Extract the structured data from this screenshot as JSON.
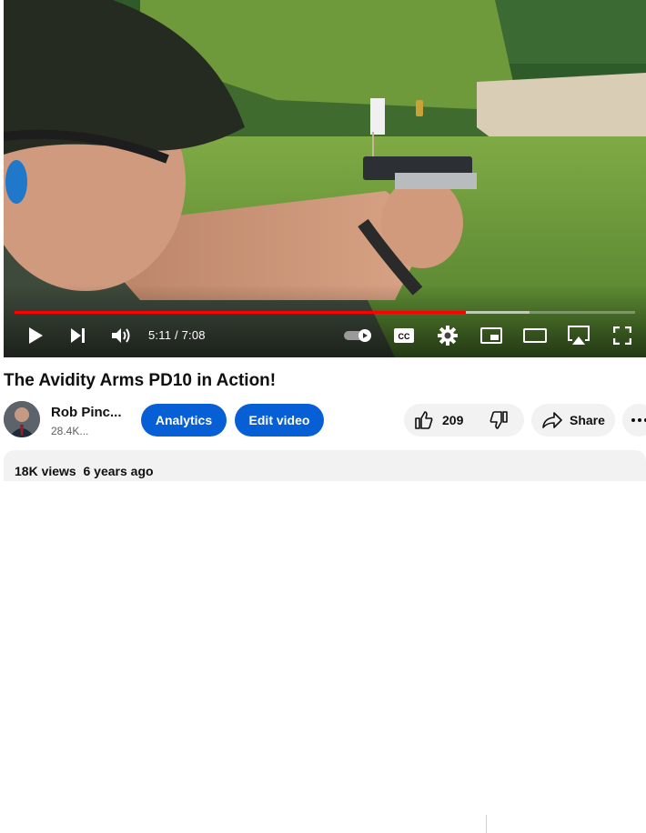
{
  "player": {
    "time_display": "5:11 / 7:08",
    "progress_fraction": 0.727,
    "buffered_fraction": 0.83,
    "accent_color": "#ff0000",
    "controls": [
      "play-icon",
      "next-icon",
      "volume-icon",
      "autoplay-toggle",
      "captions-icon",
      "settings-icon",
      "miniplayer-icon",
      "theater-icon",
      "airplay-icon",
      "fullscreen-icon"
    ],
    "captions_label": "CC"
  },
  "video": {
    "title": "The Avidity Arms PD10 in Action!"
  },
  "channel": {
    "name": "Rob Pinc...",
    "subscribers": "28.4K..."
  },
  "actions": {
    "analytics_label": "Analytics",
    "edit_label": "Edit video",
    "like_count": "209",
    "share_label": "Share",
    "brand_blue": "#065fd4"
  },
  "description": {
    "views": "18K views",
    "age": "6 years ago"
  }
}
